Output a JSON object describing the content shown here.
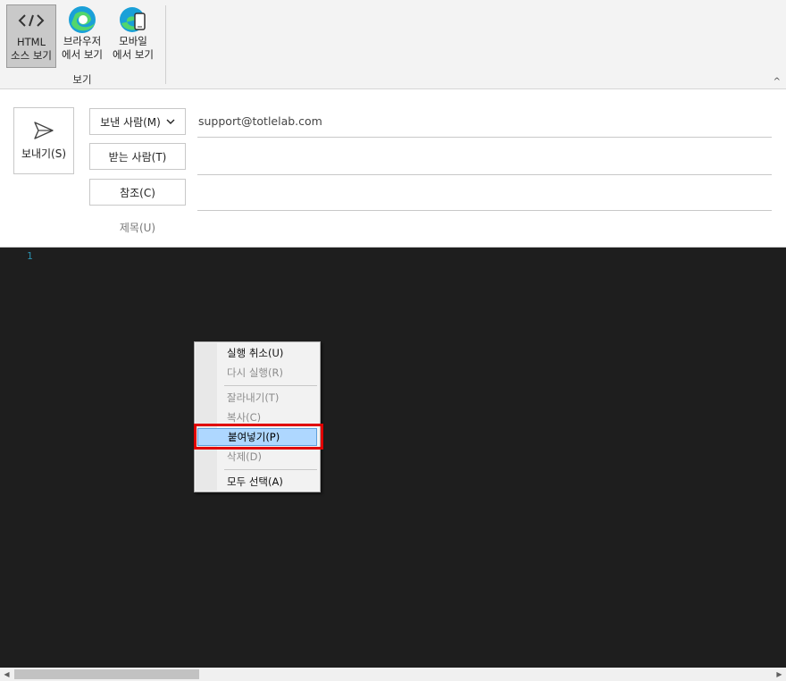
{
  "ribbon": {
    "buttons": [
      {
        "label": "HTML\n소스 보기",
        "icon": "code-icon",
        "active": true
      },
      {
        "label": "브라우저\n에서 보기",
        "icon": "edge-browser-icon",
        "active": false
      },
      {
        "label": "모바일\n에서 보기",
        "icon": "edge-mobile-icon",
        "active": false
      }
    ],
    "group_label": "보기",
    "collapse_icon": "^"
  },
  "compose": {
    "send_label": "보내기(S)",
    "from_label": "보낸 사람(M)",
    "from_value": "support@totlelab.com",
    "to_label": "받는 사람(T)",
    "to_value": "",
    "cc_label": "참조(C)",
    "cc_value": "",
    "subject_label": "제목(U)"
  },
  "editor": {
    "line_number": "1"
  },
  "context_menu": {
    "items": [
      {
        "label": "실행 취소(U)",
        "state": "enabled"
      },
      {
        "label": "다시 실행(R)",
        "state": "disabled"
      },
      {
        "label": "잘라내기(T)",
        "state": "disabled"
      },
      {
        "label": "복사(C)",
        "state": "disabled"
      },
      {
        "label": "붙여넣기(P)",
        "state": "highlighted"
      },
      {
        "label": "삭제(D)",
        "state": "disabled"
      },
      {
        "label": "모두 선택(A)",
        "state": "enabled"
      }
    ]
  },
  "colors": {
    "editor_bg": "#1e1e1e",
    "highlight": "#aed7ff",
    "callout_red": "#e00000",
    "line_number": "#2b91af"
  }
}
